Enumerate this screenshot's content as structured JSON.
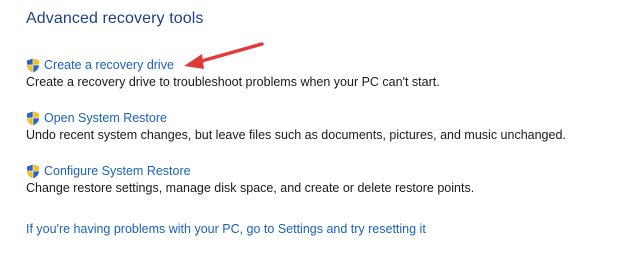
{
  "page": {
    "title": "Advanced recovery tools"
  },
  "tools": [
    {
      "link": "Create a recovery drive",
      "description": "Create a recovery drive to troubleshoot problems when your PC can't start.",
      "icon": "uac-shield-icon"
    },
    {
      "link": "Open System Restore",
      "description": "Undo recent system changes, but leave files such as documents, pictures, and music unchanged.",
      "icon": "uac-shield-icon"
    },
    {
      "link": "Configure System Restore",
      "description": "Change restore settings, manage disk space, and create or delete restore points.",
      "icon": "uac-shield-icon"
    }
  ],
  "footer": {
    "reset_link": "If you're having problems with your PC, go to Settings and try resetting it"
  },
  "colors": {
    "title": "#1e3f8a",
    "link": "#1a62b8",
    "arrow": "#e03a3a"
  }
}
